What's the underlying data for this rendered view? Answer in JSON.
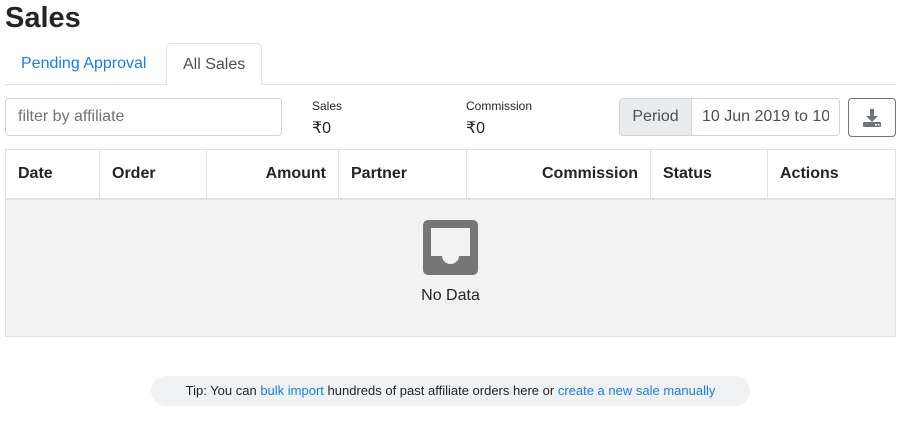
{
  "page": {
    "title": "Sales"
  },
  "tabs": [
    {
      "label": "Pending Approval",
      "active": false
    },
    {
      "label": "All Sales",
      "active": true
    }
  ],
  "filter": {
    "placeholder": "filter by affiliate",
    "value": ""
  },
  "stats": {
    "sales": {
      "label": "Sales",
      "value": "₹0"
    },
    "commission": {
      "label": "Commission",
      "value": "₹0"
    }
  },
  "period": {
    "label": "Period",
    "value": "10 Jun 2019 to 10"
  },
  "download": {
    "icon": "download-icon"
  },
  "table": {
    "columns": [
      "Date",
      "Order",
      "Amount",
      "Partner",
      "Commission",
      "Status",
      "Actions"
    ],
    "rows": [],
    "empty_text": "No Data",
    "empty_icon": "inbox-icon"
  },
  "tip": {
    "prefix": "Tip: You can ",
    "link1": "bulk import",
    "middle": " hundreds of past affiliate orders here or ",
    "link2": "create a new sale manually"
  },
  "colors": {
    "accent": "#1a7ee6",
    "empty_bg": "#f2f2f2",
    "icon": "#767676"
  }
}
